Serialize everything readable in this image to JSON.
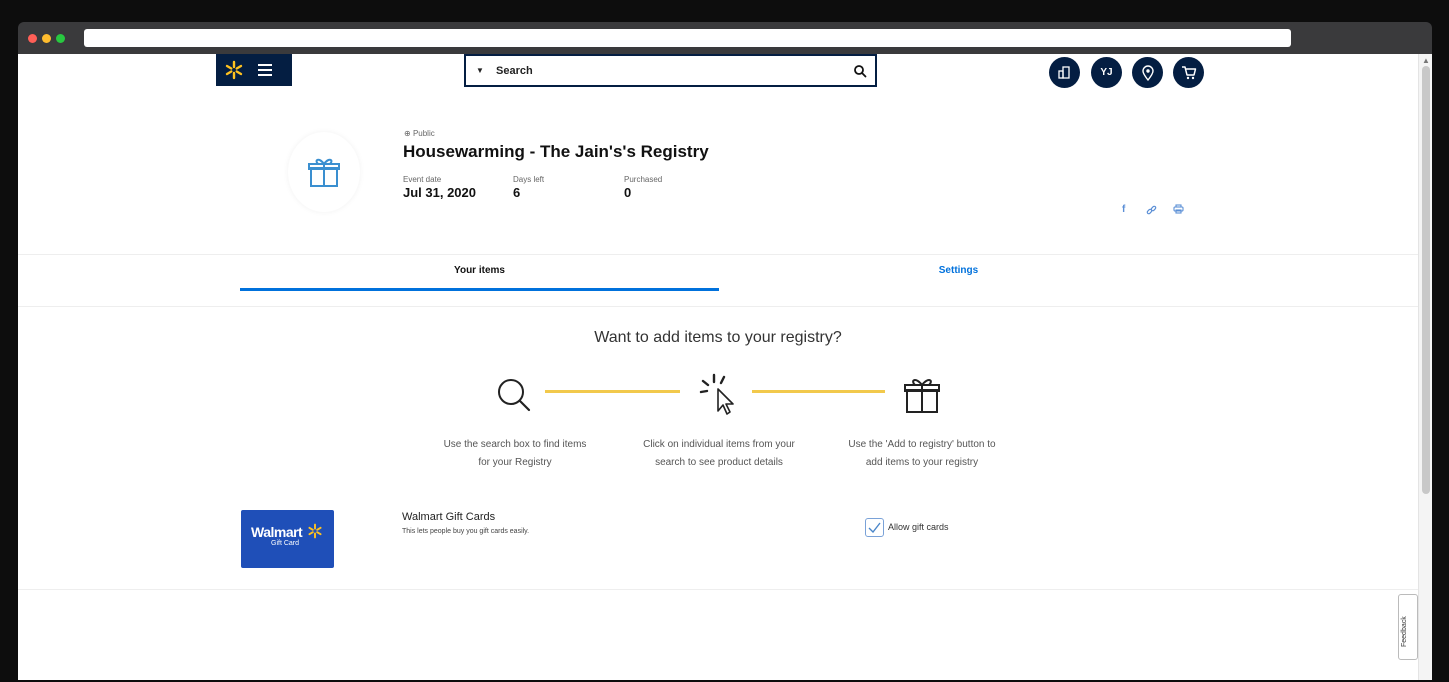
{
  "header": {
    "search_placeholder": "Search",
    "account_initials": "YJ"
  },
  "registry": {
    "visibility": "Public",
    "title": "Housewarming - The Jain's's Registry",
    "event_date_label": "Event date",
    "event_date": "Jul 31, 2020",
    "days_left_label": "Days left",
    "days_left": "6",
    "purchased_label": "Purchased",
    "purchased": "0",
    "share_icons": [
      "facebook-icon",
      "link-icon",
      "print-icon"
    ]
  },
  "tabs": [
    {
      "label": "Your items",
      "active": true
    },
    {
      "label": "Settings",
      "active": false
    }
  ],
  "how_to": {
    "title": "Want to add items to your registry?",
    "steps": [
      {
        "icon": "search-icon",
        "text1": "Use the search box to find items",
        "text2": "for your Registry"
      },
      {
        "icon": "click-cursor-icon",
        "text1": "Click on individual items from your",
        "text2": "search to see product details"
      },
      {
        "icon": "gift-icon",
        "text1": "Use the 'Add to registry' button to",
        "text2": "add items to your registry"
      }
    ]
  },
  "gift_cards": {
    "card_brand": "Walmart",
    "card_sub": "Gift Card",
    "title": "Walmart Gift Cards",
    "description": "This lets people buy you gift cards easily.",
    "checkbox_label": "Allow gift cards",
    "checked": true
  },
  "feedback_label": "Feedback",
  "colors": {
    "navy": "#041e42",
    "blue": "#0071dc",
    "yellow": "#f2c94c",
    "spark": "#ffc220"
  }
}
